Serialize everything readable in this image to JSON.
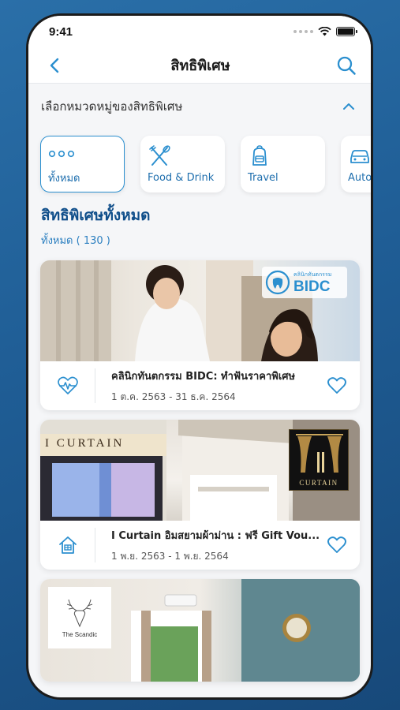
{
  "status_bar": {
    "time": "9:41"
  },
  "header": {
    "title": "สิทธิพิเศษ",
    "back_icon": "chevron-left-icon",
    "search_icon": "search-icon"
  },
  "category_selector": {
    "label": "เลือกหมวดหมู่ของสิทธิพิเศษ",
    "toggle_icon": "chevron-up-icon"
  },
  "categories": [
    {
      "label": "ทั้งหมด",
      "icon": "dots-icon",
      "active": true
    },
    {
      "label": "Food & Drink",
      "icon": "fork-knife-icon",
      "active": false
    },
    {
      "label": "Travel",
      "icon": "backpack-icon",
      "active": false
    },
    {
      "label": "Auto",
      "icon": "car-icon",
      "active": false
    }
  ],
  "section": {
    "title": "สิทธิพิเศษทั้งหมด",
    "count_text": "ทั้งหมด ( 130 )"
  },
  "deals": [
    {
      "title": "คลินิกทันตกรรม BIDC: ทำฟันราคาพิเศษ",
      "date": "1 ต.ค. 2563 - 31 ธ.ค. 2564",
      "category_icon": "heartbeat-icon",
      "logo_text": "BIDC",
      "logo_caption": "คลินิกทันตกรรม"
    },
    {
      "title": "I Curtain อิมสยามผ้าม่าน : ฟรี Gift Vou...",
      "date": "1 พ.ย. 2563 - 1 พ.ย. 2564",
      "category_icon": "home-icon",
      "sign_text": "I CURTAIN",
      "logo_text": "CURTAIN"
    },
    {
      "title": "",
      "date": "",
      "category_icon": "",
      "logo_text": "The Scandic"
    }
  ],
  "colors": {
    "accent": "#2b8fcf",
    "title_blue": "#0f4e8a",
    "background": "#1f5d95"
  }
}
